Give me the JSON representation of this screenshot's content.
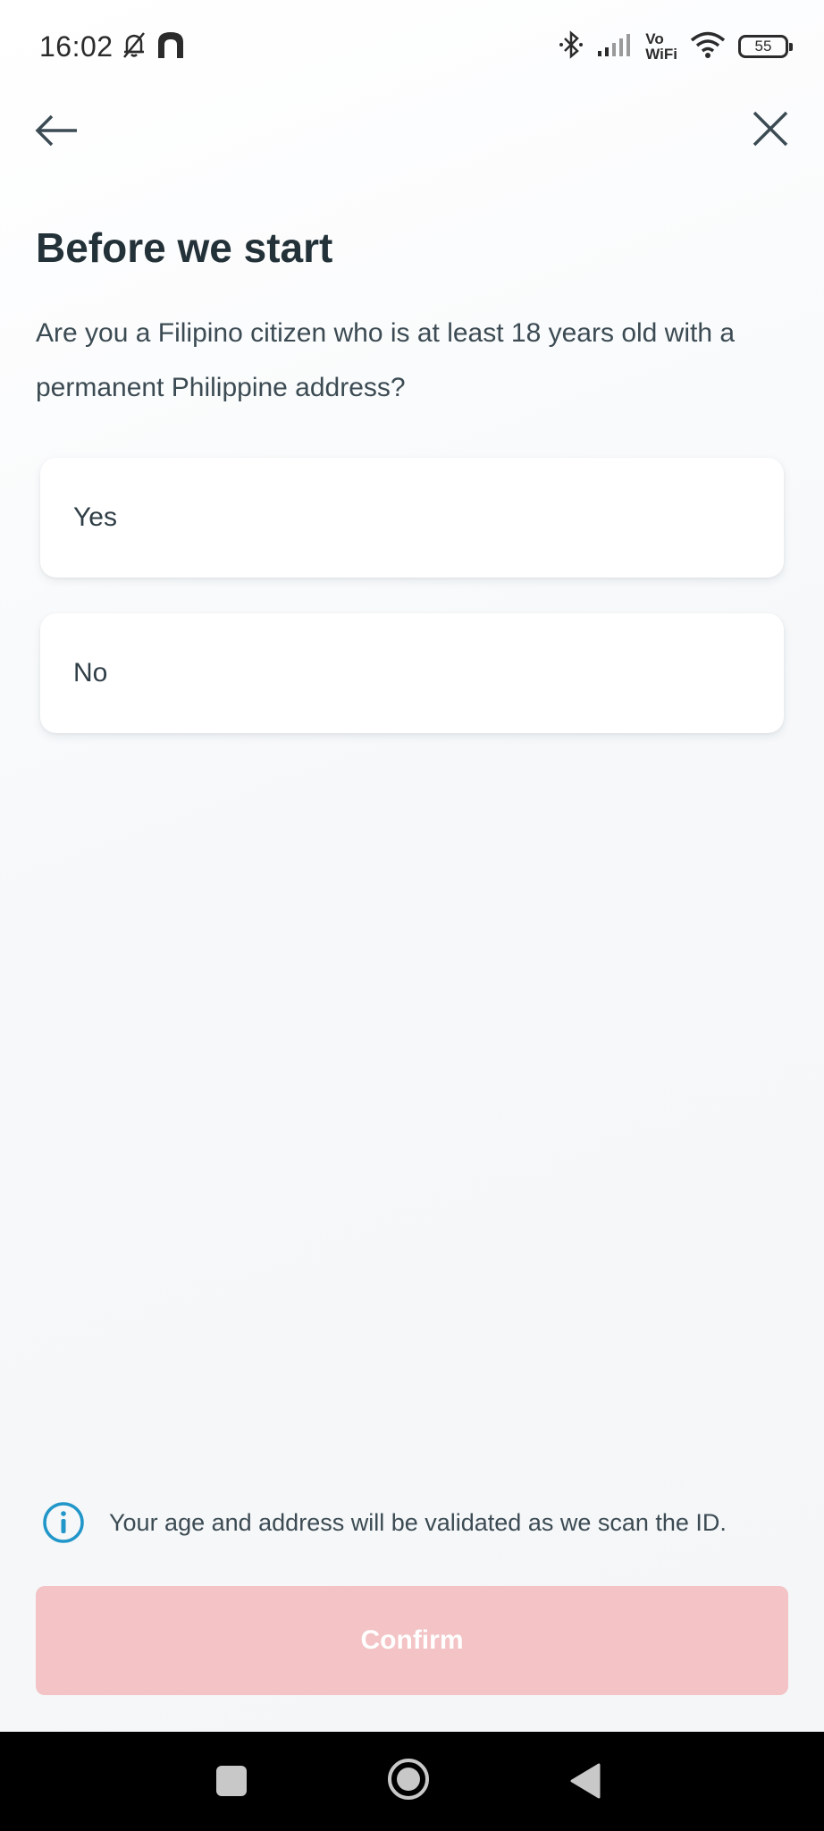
{
  "status_bar": {
    "time": "16:02",
    "vowifi_top": "Vo",
    "vowifi_bottom": "WiFi",
    "battery": "55"
  },
  "nav": {
    "back_icon": "arrow-left-icon",
    "close_icon": "close-icon"
  },
  "page": {
    "title": "Before we start",
    "question": "Are you a Filipino citizen who is at least 18 years old with a permanent Philippine address?"
  },
  "options": [
    {
      "label": "Yes"
    },
    {
      "label": "No"
    }
  ],
  "info": {
    "icon": "info-icon",
    "text": "Your age and address will be validated as we scan the ID."
  },
  "confirm": {
    "label": "Confirm",
    "state": "disabled"
  },
  "colors": {
    "confirm_disabled_bg": "#f3c3c5",
    "info_icon": "#2196c9",
    "title_text": "#233138"
  }
}
